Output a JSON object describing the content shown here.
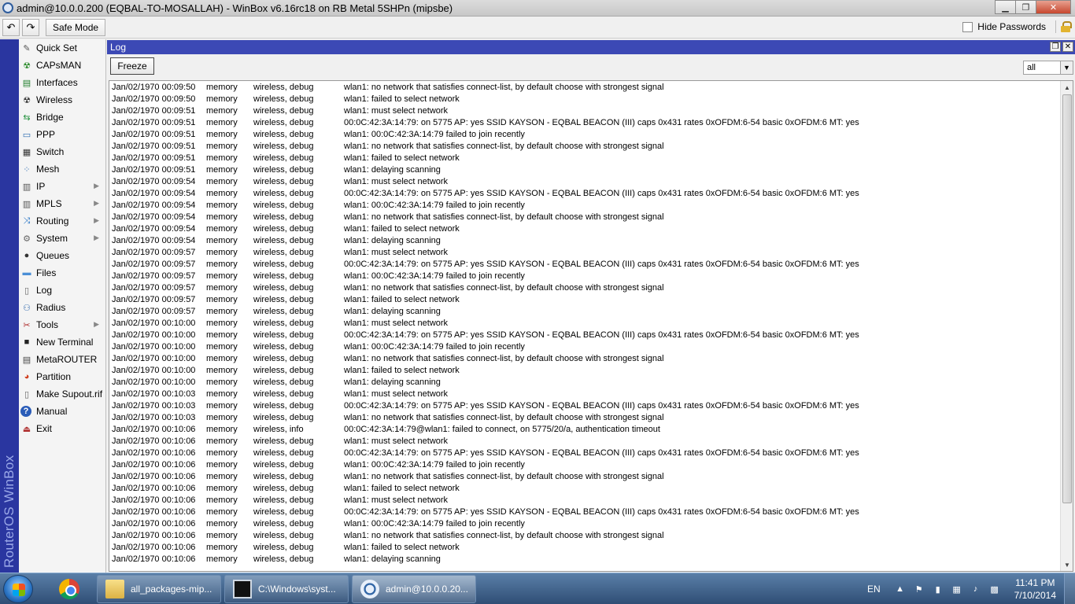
{
  "window": {
    "title": "admin@10.0.0.200 (EQBAL-TO-MOSALLAH) - WinBox v6.16rc18 on RB Metal 5SHPn (mipsbe)",
    "minimize": "▁",
    "maximize": "❐",
    "close": "✕"
  },
  "toolbar": {
    "undo": "↶",
    "redo": "↷",
    "safe_mode": "Safe Mode",
    "hide_passwords": "Hide Passwords"
  },
  "brand": "RouterOS WinBox",
  "sidebar": {
    "items": [
      {
        "label": "Quick Set",
        "icon": "quick-set-icon",
        "glyph": "✎",
        "color": "#555"
      },
      {
        "label": "CAPsMAN",
        "icon": "capsman-icon",
        "glyph": "☢",
        "color": "#2a8a2a"
      },
      {
        "label": "Interfaces",
        "icon": "interfaces-icon",
        "glyph": "▤",
        "color": "#1e7d2a"
      },
      {
        "label": "Wireless",
        "icon": "wireless-icon",
        "glyph": "☢",
        "color": "#333"
      },
      {
        "label": "Bridge",
        "icon": "bridge-icon",
        "glyph": "⇆",
        "color": "#1f8f3a"
      },
      {
        "label": "PPP",
        "icon": "ppp-icon",
        "glyph": "▭",
        "color": "#2a6ab0"
      },
      {
        "label": "Switch",
        "icon": "switch-icon",
        "glyph": "▦",
        "color": "#333"
      },
      {
        "label": "Mesh",
        "icon": "mesh-icon",
        "glyph": "⁘",
        "color": "#2a6ab0"
      },
      {
        "label": "IP",
        "icon": "ip-icon",
        "glyph": "▥",
        "color": "#555",
        "submenu": true
      },
      {
        "label": "MPLS",
        "icon": "mpls-icon",
        "glyph": "▥",
        "color": "#555",
        "submenu": true
      },
      {
        "label": "Routing",
        "icon": "routing-icon",
        "glyph": "⤨",
        "color": "#1f6fc4",
        "submenu": true
      },
      {
        "label": "System",
        "icon": "system-icon",
        "glyph": "⚙",
        "color": "#666",
        "submenu": true
      },
      {
        "label": "Queues",
        "icon": "queues-icon",
        "glyph": "●",
        "color": "#333"
      },
      {
        "label": "Files",
        "icon": "files-icon",
        "glyph": "▬",
        "color": "#4a8ed6"
      },
      {
        "label": "Log",
        "icon": "log-icon",
        "glyph": "▯",
        "color": "#666"
      },
      {
        "label": "Radius",
        "icon": "radius-icon",
        "glyph": "⚇",
        "color": "#3a6fb0"
      },
      {
        "label": "Tools",
        "icon": "tools-icon",
        "glyph": "✂",
        "color": "#b03030",
        "submenu": true
      },
      {
        "label": "New Terminal",
        "icon": "terminal-icon",
        "glyph": "■",
        "color": "#222"
      },
      {
        "label": "MetaROUTER",
        "icon": "metarouter-icon",
        "glyph": "▤",
        "color": "#444"
      },
      {
        "label": "Partition",
        "icon": "partition-icon",
        "glyph": "◕",
        "color": "#d04020"
      },
      {
        "label": "Make Supout.rif",
        "icon": "supout-icon",
        "glyph": "▯",
        "color": "#666"
      },
      {
        "label": "Manual",
        "icon": "manual-icon",
        "glyph": "?",
        "color": "#fff",
        "bg": "#2a5cb8"
      },
      {
        "label": "Exit",
        "icon": "exit-icon",
        "glyph": "⏏",
        "color": "#b03030"
      }
    ]
  },
  "log_window": {
    "title": "Log",
    "restore": "❐",
    "close": "✕",
    "freeze": "Freeze",
    "filter_value": "all",
    "entries": [
      [
        "Jan/02/1970 00:09:50",
        "memory",
        "wireless, debug",
        "wlan1: no network that satisfies connect-list,  by default choose with strongest signal"
      ],
      [
        "Jan/02/1970 00:09:50",
        "memory",
        "wireless, debug",
        "wlan1: failed to select network"
      ],
      [
        "Jan/02/1970 00:09:51",
        "memory",
        "wireless, debug",
        "wlan1: must select network"
      ],
      [
        "Jan/02/1970 00:09:51",
        "memory",
        "wireless, debug",
        "00:0C:42:3A:14:79: on 5775 AP: yes SSID KAYSON - EQBAL BEACON (III) caps 0x431 rates 0xOFDM:6-54 basic 0xOFDM:6 MT: yes"
      ],
      [
        "Jan/02/1970 00:09:51",
        "memory",
        "wireless, debug",
        "wlan1: 00:0C:42:3A:14:79 failed to join recently"
      ],
      [
        "Jan/02/1970 00:09:51",
        "memory",
        "wireless, debug",
        "wlan1: no network that satisfies connect-list,  by default choose with strongest signal"
      ],
      [
        "Jan/02/1970 00:09:51",
        "memory",
        "wireless, debug",
        "wlan1: failed to select network"
      ],
      [
        "Jan/02/1970 00:09:51",
        "memory",
        "wireless, debug",
        "wlan1: delaying scanning"
      ],
      [
        "Jan/02/1970 00:09:54",
        "memory",
        "wireless, debug",
        "wlan1: must select network"
      ],
      [
        "Jan/02/1970 00:09:54",
        "memory",
        "wireless, debug",
        "00:0C:42:3A:14:79: on 5775 AP: yes SSID KAYSON - EQBAL BEACON (III) caps 0x431 rates 0xOFDM:6-54 basic 0xOFDM:6 MT: yes"
      ],
      [
        "Jan/02/1970 00:09:54",
        "memory",
        "wireless, debug",
        "wlan1: 00:0C:42:3A:14:79 failed to join recently"
      ],
      [
        "Jan/02/1970 00:09:54",
        "memory",
        "wireless, debug",
        "wlan1: no network that satisfies connect-list,  by default choose with strongest signal"
      ],
      [
        "Jan/02/1970 00:09:54",
        "memory",
        "wireless, debug",
        "wlan1: failed to select network"
      ],
      [
        "Jan/02/1970 00:09:54",
        "memory",
        "wireless, debug",
        "wlan1: delaying scanning"
      ],
      [
        "Jan/02/1970 00:09:57",
        "memory",
        "wireless, debug",
        "wlan1: must select network"
      ],
      [
        "Jan/02/1970 00:09:57",
        "memory",
        "wireless, debug",
        "00:0C:42:3A:14:79: on 5775 AP: yes SSID KAYSON - EQBAL BEACON (III) caps 0x431 rates 0xOFDM:6-54 basic 0xOFDM:6 MT: yes"
      ],
      [
        "Jan/02/1970 00:09:57",
        "memory",
        "wireless, debug",
        "wlan1: 00:0C:42:3A:14:79 failed to join recently"
      ],
      [
        "Jan/02/1970 00:09:57",
        "memory",
        "wireless, debug",
        "wlan1: no network that satisfies connect-list,  by default choose with strongest signal"
      ],
      [
        "Jan/02/1970 00:09:57",
        "memory",
        "wireless, debug",
        "wlan1: failed to select network"
      ],
      [
        "Jan/02/1970 00:09:57",
        "memory",
        "wireless, debug",
        "wlan1: delaying scanning"
      ],
      [
        "Jan/02/1970 00:10:00",
        "memory",
        "wireless, debug",
        "wlan1: must select network"
      ],
      [
        "Jan/02/1970 00:10:00",
        "memory",
        "wireless, debug",
        "00:0C:42:3A:14:79: on 5775 AP: yes SSID KAYSON - EQBAL BEACON (III) caps 0x431 rates 0xOFDM:6-54 basic 0xOFDM:6 MT: yes"
      ],
      [
        "Jan/02/1970 00:10:00",
        "memory",
        "wireless, debug",
        "wlan1: 00:0C:42:3A:14:79 failed to join recently"
      ],
      [
        "Jan/02/1970 00:10:00",
        "memory",
        "wireless, debug",
        "wlan1: no network that satisfies connect-list,  by default choose with strongest signal"
      ],
      [
        "Jan/02/1970 00:10:00",
        "memory",
        "wireless, debug",
        "wlan1: failed to select network"
      ],
      [
        "Jan/02/1970 00:10:00",
        "memory",
        "wireless, debug",
        "wlan1: delaying scanning"
      ],
      [
        "Jan/02/1970 00:10:03",
        "memory",
        "wireless, debug",
        "wlan1: must select network"
      ],
      [
        "Jan/02/1970 00:10:03",
        "memory",
        "wireless, debug",
        "00:0C:42:3A:14:79: on 5775 AP: yes SSID KAYSON - EQBAL BEACON (III) caps 0x431 rates 0xOFDM:6-54 basic 0xOFDM:6 MT: yes"
      ],
      [
        "Jan/02/1970 00:10:03",
        "memory",
        "wireless, debug",
        "wlan1: no network that satisfies connect-list,  by default choose with strongest signal"
      ],
      [
        "Jan/02/1970 00:10:06",
        "memory",
        "wireless, info",
        "00:0C:42:3A:14:79@wlan1: failed to connect, on 5775/20/a, authentication timeout"
      ],
      [
        "Jan/02/1970 00:10:06",
        "memory",
        "wireless, debug",
        "wlan1: must select network"
      ],
      [
        "Jan/02/1970 00:10:06",
        "memory",
        "wireless, debug",
        "00:0C:42:3A:14:79: on 5775 AP: yes SSID KAYSON - EQBAL BEACON (III) caps 0x431 rates 0xOFDM:6-54 basic 0xOFDM:6 MT: yes"
      ],
      [
        "Jan/02/1970 00:10:06",
        "memory",
        "wireless, debug",
        "wlan1: 00:0C:42:3A:14:79 failed to join recently"
      ],
      [
        "Jan/02/1970 00:10:06",
        "memory",
        "wireless, debug",
        "wlan1: no network that satisfies connect-list,  by default choose with strongest signal"
      ],
      [
        "Jan/02/1970 00:10:06",
        "memory",
        "wireless, debug",
        "wlan1: failed to select network"
      ],
      [
        "Jan/02/1970 00:10:06",
        "memory",
        "wireless, debug",
        "wlan1: must select network"
      ],
      [
        "Jan/02/1970 00:10:06",
        "memory",
        "wireless, debug",
        "00:0C:42:3A:14:79: on 5775 AP: yes SSID KAYSON - EQBAL BEACON (III) caps 0x431 rates 0xOFDM:6-54 basic 0xOFDM:6 MT: yes"
      ],
      [
        "Jan/02/1970 00:10:06",
        "memory",
        "wireless, debug",
        "wlan1: 00:0C:42:3A:14:79 failed to join recently"
      ],
      [
        "Jan/02/1970 00:10:06",
        "memory",
        "wireless, debug",
        "wlan1: no network that satisfies connect-list,  by default choose with strongest signal"
      ],
      [
        "Jan/02/1970 00:10:06",
        "memory",
        "wireless, debug",
        "wlan1: failed to select network"
      ],
      [
        "Jan/02/1970 00:10:06",
        "memory",
        "wireless, debug",
        "wlan1: delaying scanning"
      ]
    ]
  },
  "taskbar": {
    "tasks": [
      {
        "label": "all_packages-mip...",
        "icon": "folder-icon"
      },
      {
        "label": "C:\\Windows\\syst...",
        "icon": "cmd-icon"
      },
      {
        "label": "admin@10.0.0.20...",
        "icon": "winbox-icon",
        "active": true
      }
    ],
    "language": "EN",
    "time": "11:41 PM",
    "date": "7/10/2014"
  }
}
